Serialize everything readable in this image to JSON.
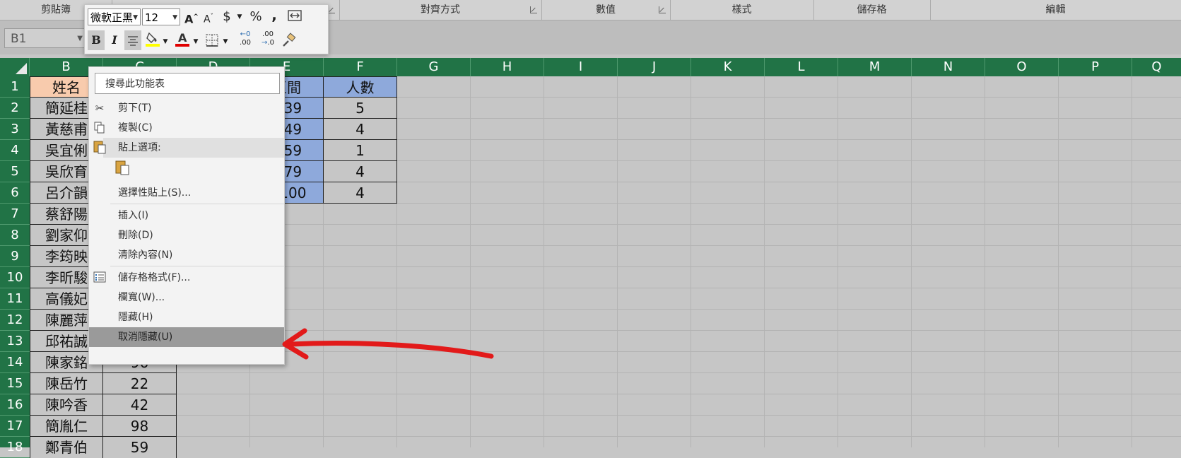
{
  "ribbon": {
    "groups": [
      "剪貼簿",
      "對齊方式",
      "數值",
      "樣式",
      "儲存格",
      "編輯"
    ]
  },
  "name_box": {
    "value": "B1"
  },
  "mini_toolbar": {
    "font_name": "微軟正黑",
    "font_size": "12",
    "grow_font": "A",
    "shrink_font": "A",
    "currency": "$",
    "percent": "%",
    "comma": ",",
    "bold": "B",
    "italic": "I",
    "increase_decimal": ".00",
    "decrease_decimal": ".0",
    "colors": {
      "highlight": "#ffff00",
      "font_color": "#e00000"
    }
  },
  "columns": [
    "B",
    "C",
    "D",
    "E",
    "F",
    "G",
    "H",
    "I",
    "J",
    "K",
    "L",
    "M",
    "N",
    "O",
    "P",
    "Q"
  ],
  "rows": [
    "1",
    "2",
    "3",
    "4",
    "5",
    "6",
    "7",
    "8",
    "9",
    "10",
    "11",
    "12",
    "13",
    "14",
    "15",
    "16",
    "17",
    "18"
  ],
  "sheet": {
    "col_b": {
      "header": "姓名",
      "names": [
        "簡延桂",
        "黃慈甫",
        "吳宜俐",
        "吳欣育",
        "呂介韻",
        "蔡舒陽",
        "劉家仰",
        "李筠映",
        "李昕駿",
        "高儀妃",
        "陳麗萍",
        "邱祐誠",
        "陳家銘",
        "陳岳竹",
        "陳吟香",
        "簡胤仁",
        "鄭青伯"
      ]
    },
    "col_c_visible": [
      "22",
      "42",
      "98",
      "59"
    ],
    "col_c_partial": "96",
    "col_e": {
      "header": "區間",
      "values": [
        "~39",
        "~49",
        "~59",
        "~79",
        "~100"
      ]
    },
    "col_f": {
      "header": "人數",
      "values": [
        "5",
        "4",
        "1",
        "4",
        "4"
      ]
    }
  },
  "context_menu": {
    "search_placeholder": "搜尋此功能表",
    "items": {
      "cut": "剪下(T)",
      "copy": "複製(C)",
      "paste_options": "貼上選項:",
      "paste_special": "選擇性貼上(S)...",
      "insert": "插入(I)",
      "delete": "刪除(D)",
      "clear": "清除內容(N)",
      "format_cells": "儲存格格式(F)...",
      "column_width": "欄寬(W)...",
      "hide": "隱藏(H)",
      "unhide": "取消隱藏(U)"
    }
  },
  "annotation": {
    "arrow_color": "#e21a1a"
  },
  "theme": {
    "excel_green": "#217346",
    "header_fill": "#f8cbad",
    "table_fill": "#8ea9db"
  }
}
